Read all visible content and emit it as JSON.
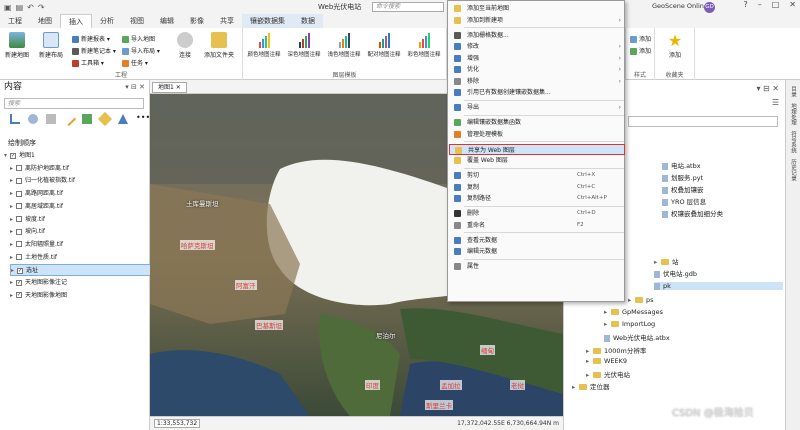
{
  "titlebar": {
    "title": "Web光伏电站",
    "search_placeholder": "命令搜索",
    "account": "GeoScene Online",
    "avatar": "GD"
  },
  "tabs": [
    "工程",
    "地图",
    "插入",
    "分析",
    "视图",
    "编辑",
    "影像",
    "共享",
    "镶嵌数据集",
    "数据"
  ],
  "active_tab": "插入",
  "ribbon": {
    "new_map": "新建地图",
    "new_layout": "新建布局",
    "new_report": "新建报表",
    "new_notebook": "新建笔记本",
    "toolbox": "工具箱",
    "import_map": "导入地图",
    "import_layout": "导入布局",
    "task": "任务",
    "connect": "连接",
    "add_folder": "添加文件夹",
    "group_project": "工程",
    "group_layer_template": "图层模板",
    "sym": [
      "颜色地图注释",
      "深色地图注释",
      "浅色地图注释",
      "配对地图注释",
      "彩色地图注释"
    ],
    "add_r1": "添加",
    "add_r2": "添加",
    "group_style": "样式",
    "add_fav": "添加",
    "group_fav": "收藏夹"
  },
  "contents": {
    "title": "内容",
    "search_placeholder": "搜索",
    "section": "绘制顺序",
    "layers": [
      {
        "name": "地图1",
        "checked": true,
        "root": true
      },
      {
        "name": "离防护地距离.tif",
        "checked": false
      },
      {
        "name": "归一化植被指数.tif",
        "checked": false
      },
      {
        "name": "离路网距离.tif",
        "checked": false
      },
      {
        "name": "离居域距离.tif",
        "checked": false
      },
      {
        "name": "坡度.tif",
        "checked": false
      },
      {
        "name": "坡向.tif",
        "checked": false
      },
      {
        "name": "太阳辐照量.tif",
        "checked": false
      },
      {
        "name": "土地性质.tif",
        "checked": false
      },
      {
        "name": "选址",
        "checked": true,
        "selected": true
      },
      {
        "name": "天地图影像注记",
        "checked": true
      },
      {
        "name": "天地图影像地图",
        "checked": true
      }
    ]
  },
  "map": {
    "tab": "地图1",
    "labels": [
      "哈萨克斯坦",
      "巴基斯坦",
      "印度",
      "尼泊尔",
      "孟加拉",
      "缅甸",
      "老挝",
      "斯里兰卡",
      "阿富汗",
      "土库曼斯坦"
    ],
    "scale": "1:33,553,732",
    "coords": "17,372,042.55E 6,730,664.94N m"
  },
  "context_menu": {
    "items": [
      {
        "label": "添加至当前地图",
        "sub": false
      },
      {
        "label": "添加到新建项",
        "sub": true
      },
      {
        "label": "添加栅格数据...",
        "sub": false
      },
      {
        "label": "修改",
        "sub": true
      },
      {
        "label": "增强",
        "sub": true
      },
      {
        "label": "优化",
        "sub": true
      },
      {
        "label": "移除",
        "sub": true
      },
      {
        "label": "引用已有数据创建镶嵌数据集...",
        "sub": false
      },
      {
        "label": "导出",
        "sub": true
      },
      {
        "label": "编辑镶嵌数据集函数",
        "sub": false
      },
      {
        "label": "管理处理模板",
        "sub": false
      },
      {
        "label": "共享为 Web 图层",
        "sub": false,
        "highlight": true
      },
      {
        "label": "覆盖 Web 图层",
        "sub": false
      },
      {
        "label": "剪切",
        "shortcut": "Ctrl+X"
      },
      {
        "label": "复制",
        "shortcut": "Ctrl+C"
      },
      {
        "label": "复制路径",
        "shortcut": "Ctrl+Alt+P"
      },
      {
        "label": "删除",
        "shortcut": "Ctrl+D"
      },
      {
        "label": "重命名",
        "shortcut": "F2"
      },
      {
        "label": "查看元数据"
      },
      {
        "label": "编辑元数据"
      },
      {
        "label": "属性"
      }
    ]
  },
  "catalog": {
    "items": [
      "电站.atbx",
      "划服务.pyt",
      "权叠加镶嵌",
      "YRO 层信息",
      "权镶嵌叠加细分类",
      "站",
      "伏电站.gdb",
      "pk",
      "ps",
      "GpMessages",
      "ImportLog",
      "Web光伏电站.atbx",
      "1000m分辨率",
      "WEEK9",
      "光伏电站",
      "定位器"
    ]
  },
  "vstrip": [
    "目录",
    "地理处理",
    "符号系统",
    "历史记录"
  ],
  "watermark": "CSDN @极海拾贝"
}
